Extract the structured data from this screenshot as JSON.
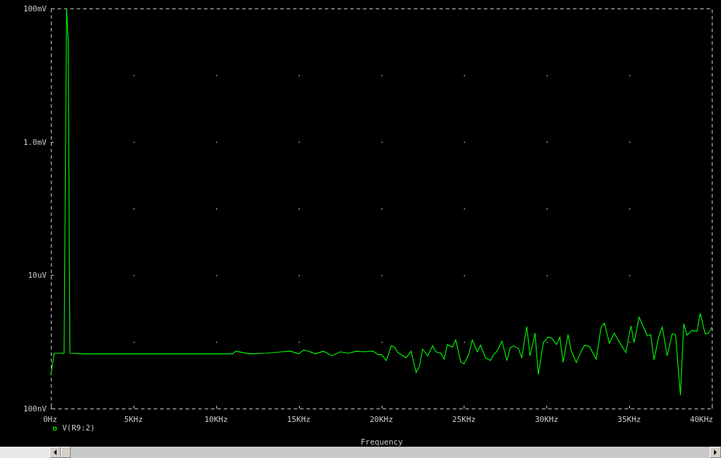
{
  "plot": {
    "y_axis_labels": [
      "100mV",
      "1.0mV",
      "10uV",
      "100nV"
    ],
    "x_axis_labels": [
      "0Hz",
      "5KHz",
      "10KHz",
      "15KHz",
      "20KHz",
      "25KHz",
      "30KHz",
      "35KHz",
      "40KHz"
    ],
    "legend": [
      {
        "label": "V(R9:2)",
        "color": "#00ff00"
      }
    ],
    "x_axis_title": "Frequency"
  }
}
